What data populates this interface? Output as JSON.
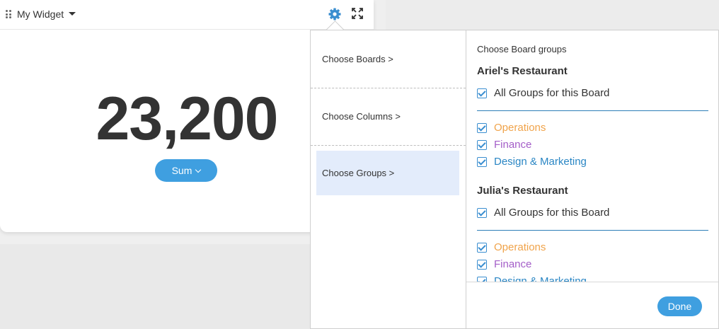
{
  "widget": {
    "title": "My Widget",
    "value": "23,200",
    "aggregation_label": "Sum"
  },
  "settings_menu": {
    "items": [
      {
        "label": "Choose Boards >"
      },
      {
        "label": "Choose Columns >"
      },
      {
        "label": "Choose Groups >",
        "active": true
      }
    ]
  },
  "groups_panel": {
    "title": "Choose Board groups",
    "boards": [
      {
        "name": "Ariel's Restaurant",
        "all_groups_label": "All Groups for this Board",
        "groups": [
          {
            "label": "Operations",
            "color": "#f0a34a"
          },
          {
            "label": "Finance",
            "color": "#a45ec8"
          },
          {
            "label": "Design & Marketing",
            "color": "#2a86c4"
          }
        ]
      },
      {
        "name": "Julia's Restaurant",
        "all_groups_label": "All Groups for this Board",
        "groups": [
          {
            "label": "Operations",
            "color": "#f0a34a"
          },
          {
            "label": "Finance",
            "color": "#a45ec8"
          },
          {
            "label": "Design & Marketing",
            "color": "#2a86c4"
          }
        ]
      }
    ],
    "done_label": "Done"
  },
  "colors": {
    "accent": "#3f9fe0",
    "checkbox": "#3a8ed0",
    "active_menu_bg": "#e3ecfb"
  }
}
